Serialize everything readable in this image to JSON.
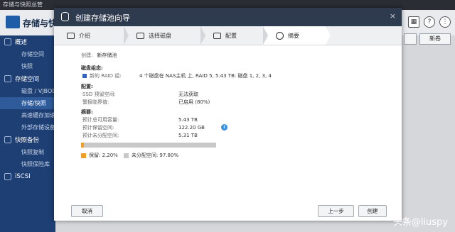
{
  "app": {
    "window_title": "存储与快照总管",
    "header_title": "存储与快照",
    "header_icons": [
      "grid-icon",
      "help-icon",
      "more-icon"
    ]
  },
  "sidebar": {
    "sections": [
      {
        "label": "概述",
        "icon": "overview-icon",
        "items": [
          "存储空间",
          "快照"
        ]
      },
      {
        "label": "存储空间",
        "icon": "storage-icon",
        "items": [
          "磁盘 / VJBOD",
          "存储/快照",
          "高速缓存加速",
          "外部存储设备"
        ]
      },
      {
        "label": "快照备份",
        "icon": "snapshot-icon",
        "items": [
          "快照复制",
          "快照保险库"
        ]
      },
      {
        "label": "iSCSI",
        "icon": "iscsi-icon",
        "items": []
      }
    ],
    "active_item": "存储/快照"
  },
  "background_buttons": {
    "right_button": "新卷"
  },
  "dialog": {
    "title": "创建存储池向导",
    "close_symbol": "×",
    "steps": [
      {
        "label": "介绍",
        "icon": "intro-icon"
      },
      {
        "label": "选择磁盘",
        "icon": "disk-icon"
      },
      {
        "label": "配置",
        "icon": "config-icon"
      },
      {
        "label": "摘要",
        "icon": "check-icon"
      }
    ],
    "active_step": 3,
    "summary": {
      "create_label": "创建:",
      "create_value": "新存储池",
      "disk_config_header": "磁盘组态:",
      "raid_group_label": "新的 RAID 组:",
      "raid_group_value": "4 个磁盘在 NAS主机 上, RAID 5, 5.43 TB: 磁盘 1, 2, 3, 4",
      "config_header": "配置:",
      "ssd_label": "SSD 预留空间:",
      "ssd_value": "无法获取",
      "alert_label": "警报临界值:",
      "alert_value": "已启用 (80%)",
      "summary_header": "摘要:",
      "est_capacity_label": "预计总可用容量:",
      "est_capacity_value": "5.43 TB",
      "est_reserved_label": "预计保留空间:",
      "est_reserved_value": "122.20 GB",
      "est_unallocated_label": "预计未分配空间:",
      "est_unallocated_value": "5.31 TB",
      "reserved_legend": "保留: 2.20%",
      "unallocated_legend": "未分配空间: 97.80%",
      "reserved_fraction": 0.022
    },
    "buttons": {
      "cancel": "取消",
      "prev": "上一步",
      "create": "创建"
    }
  },
  "colors": {
    "reserved": "#f09e2a",
    "unallocated": "#c8c8c8",
    "raid_swatch": "#2f62b8",
    "info": "#3b8fe0"
  },
  "watermark": "头条@liuspy"
}
